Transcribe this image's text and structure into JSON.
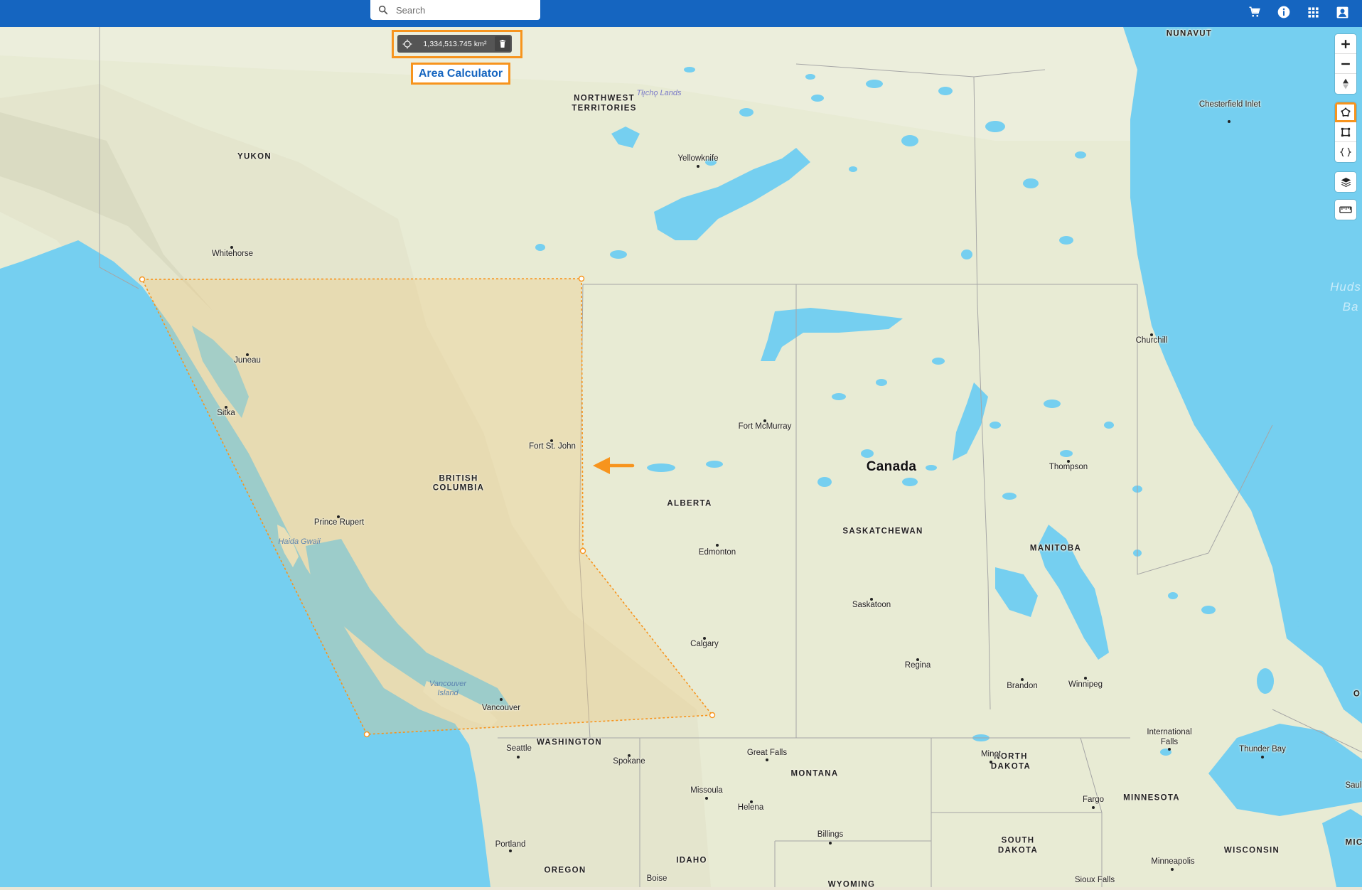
{
  "search": {
    "placeholder": "Search"
  },
  "toolbar": {
    "icons": [
      "cart-icon",
      "info-icon",
      "apps-grid-icon",
      "account-icon"
    ]
  },
  "area_calculator": {
    "value": "1,334,513.745 km²",
    "callout_label": "Area Calculator"
  },
  "map_controls": {
    "tools": [
      "zoom-in",
      "zoom-out",
      "compass",
      "draw-polygon",
      "draw-rectangle",
      "geojson",
      "layers",
      "ruler"
    ],
    "active_tool": "draw-polygon"
  },
  "colors": {
    "header": "#1565c0",
    "highlight": "#f7941d",
    "water": "#75cff0",
    "land": "#e8ebd4"
  },
  "labels": {
    "countries": [
      "Canada"
    ],
    "regions": {
      "nunavut": "NUNAVUT",
      "nwt_1": "NORTHWEST",
      "nwt_2": "TERRITORIES",
      "yukon": "YUKON",
      "bc_1": "BRITISH",
      "bc_2": "COLUMBIA",
      "alberta": "ALBERTA",
      "saskatchewan": "SASKATCHEWAN",
      "manitoba": "MANITOBA",
      "washington": "WASHINGTON",
      "montana": "MONTANA",
      "north_dakota_1": "NORTH",
      "north_dakota_2": "DAKOTA",
      "south_dakota_1": "SOUTH",
      "south_dakota_2": "DAKOTA",
      "minnesota": "MINNESOTA",
      "wisconsin": "WISCONSIN",
      "idaho": "IDAHO",
      "oregon": "OREGON",
      "wyoming": "WYOMING",
      "michigan": "MIC"
    },
    "cities": [
      "Whitehorse",
      "Yellowknife",
      "Chesterfield Inlet",
      "Juneau",
      "Sitka",
      "Fort St. John",
      "Prince Rupert",
      "Fort McMurray",
      "Churchill",
      "Thompson",
      "Edmonton",
      "Saskatoon",
      "Calgary",
      "Regina",
      "Brandon",
      "Winnipeg",
      "Vancouver",
      "Seattle",
      "Spokane",
      "Great Falls",
      "Missoula",
      "Helena",
      "Billings",
      "Minot",
      "Fargo",
      "International Falls",
      "Thunder Bay",
      "Minneapolis",
      "Portland",
      "Boise",
      "Sioux Falls",
      "Saul"
    ],
    "water": {
      "tlicho": "Tłı̨chǫ Lands",
      "haida": "Haida Gwaii",
      "vancouver_island_1": "Vancouver",
      "vancouver_island_2": "Island",
      "hudson_1": "Huds",
      "hudson_2": "Ba",
      "edge_o": "O"
    }
  }
}
